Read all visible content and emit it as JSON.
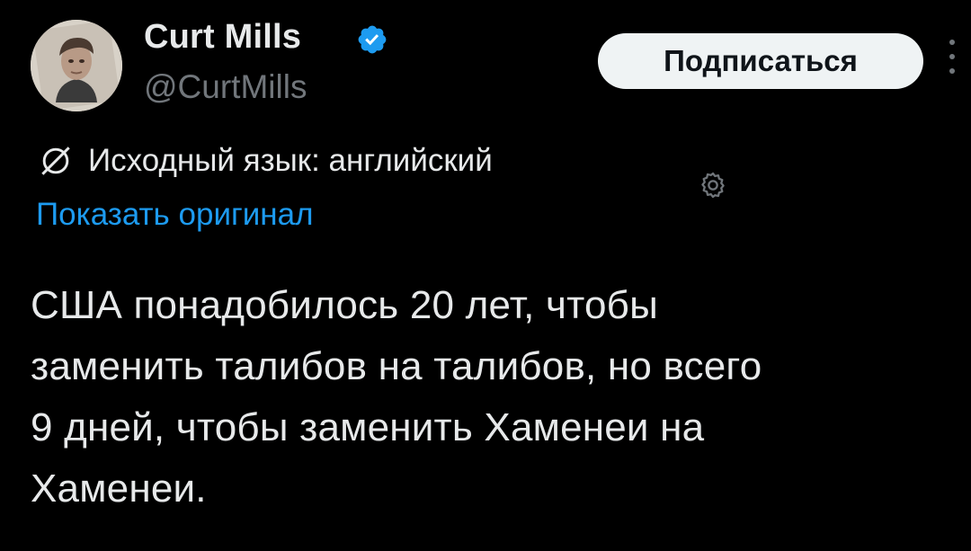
{
  "author": {
    "name": "Curt Mills",
    "handle": "@CurtMills",
    "verified": true
  },
  "actions": {
    "subscribe_label": "Подписаться",
    "more_icon": "more-vertical-icon"
  },
  "translation": {
    "notice": "Исходный язык: английский",
    "show_original": "Показать оригинал",
    "icon": "translate-icon",
    "settings_icon": "gear-icon"
  },
  "tweet": {
    "text": "США понадобилось 20 лет, чтобы\nзаменить талибов на талибов, но всего\n9 дней, чтобы заменить Хаменеи на\nХаменеи."
  },
  "colors": {
    "background": "#000000",
    "text": "#e7e9ea",
    "secondary": "#71767b",
    "link": "#1d9bf0",
    "verified": "#1d9bf0",
    "button_bg": "#eff3f4"
  }
}
